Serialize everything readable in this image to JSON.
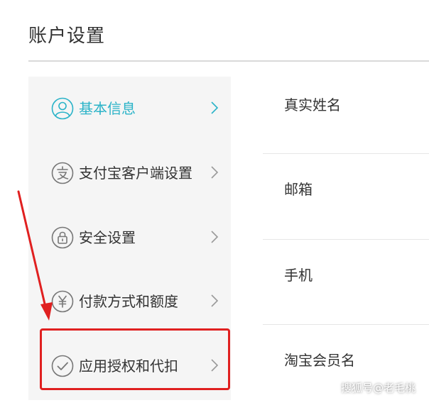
{
  "page": {
    "title": "账户设置"
  },
  "colors": {
    "accent": "#2ab3c8",
    "annotation": "#e02020",
    "sidebar_bg": "#f5f5f5"
  },
  "sidebar": {
    "items": [
      {
        "label": "基本信息",
        "icon": "user-icon",
        "active": true
      },
      {
        "label": "支付宝客户端设置",
        "icon": "alipay-icon",
        "active": false
      },
      {
        "label": "安全设置",
        "icon": "lock-icon",
        "active": false
      },
      {
        "label": "付款方式和额度",
        "icon": "yuan-icon",
        "active": false
      },
      {
        "label": "应用授权和代扣",
        "icon": "check-circle-icon",
        "active": false
      }
    ]
  },
  "content": {
    "rows": [
      {
        "label": "真实姓名"
      },
      {
        "label": "邮箱"
      },
      {
        "label": "手机"
      },
      {
        "label": "淘宝会员名"
      }
    ]
  },
  "watermark": "搜狐号@老毛桃"
}
